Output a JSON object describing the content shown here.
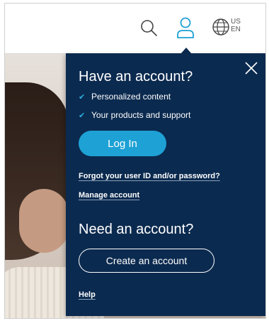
{
  "header": {
    "locale_country": "US",
    "locale_language": "EN",
    "icons": [
      "search-icon",
      "user-icon",
      "globe-icon"
    ],
    "accent_color": "#1ea1d5"
  },
  "account_panel": {
    "have_account_heading": "Have an account?",
    "benefits": [
      "Personalized content",
      "Your products and support"
    ],
    "login_label": "Log In",
    "forgot_link": "Forgot your user ID and/or password?",
    "manage_link": "Manage account",
    "need_account_heading": "Need an account?",
    "create_label": "Create an account",
    "help_link": "Help",
    "background_color": "#0b2a4f"
  }
}
